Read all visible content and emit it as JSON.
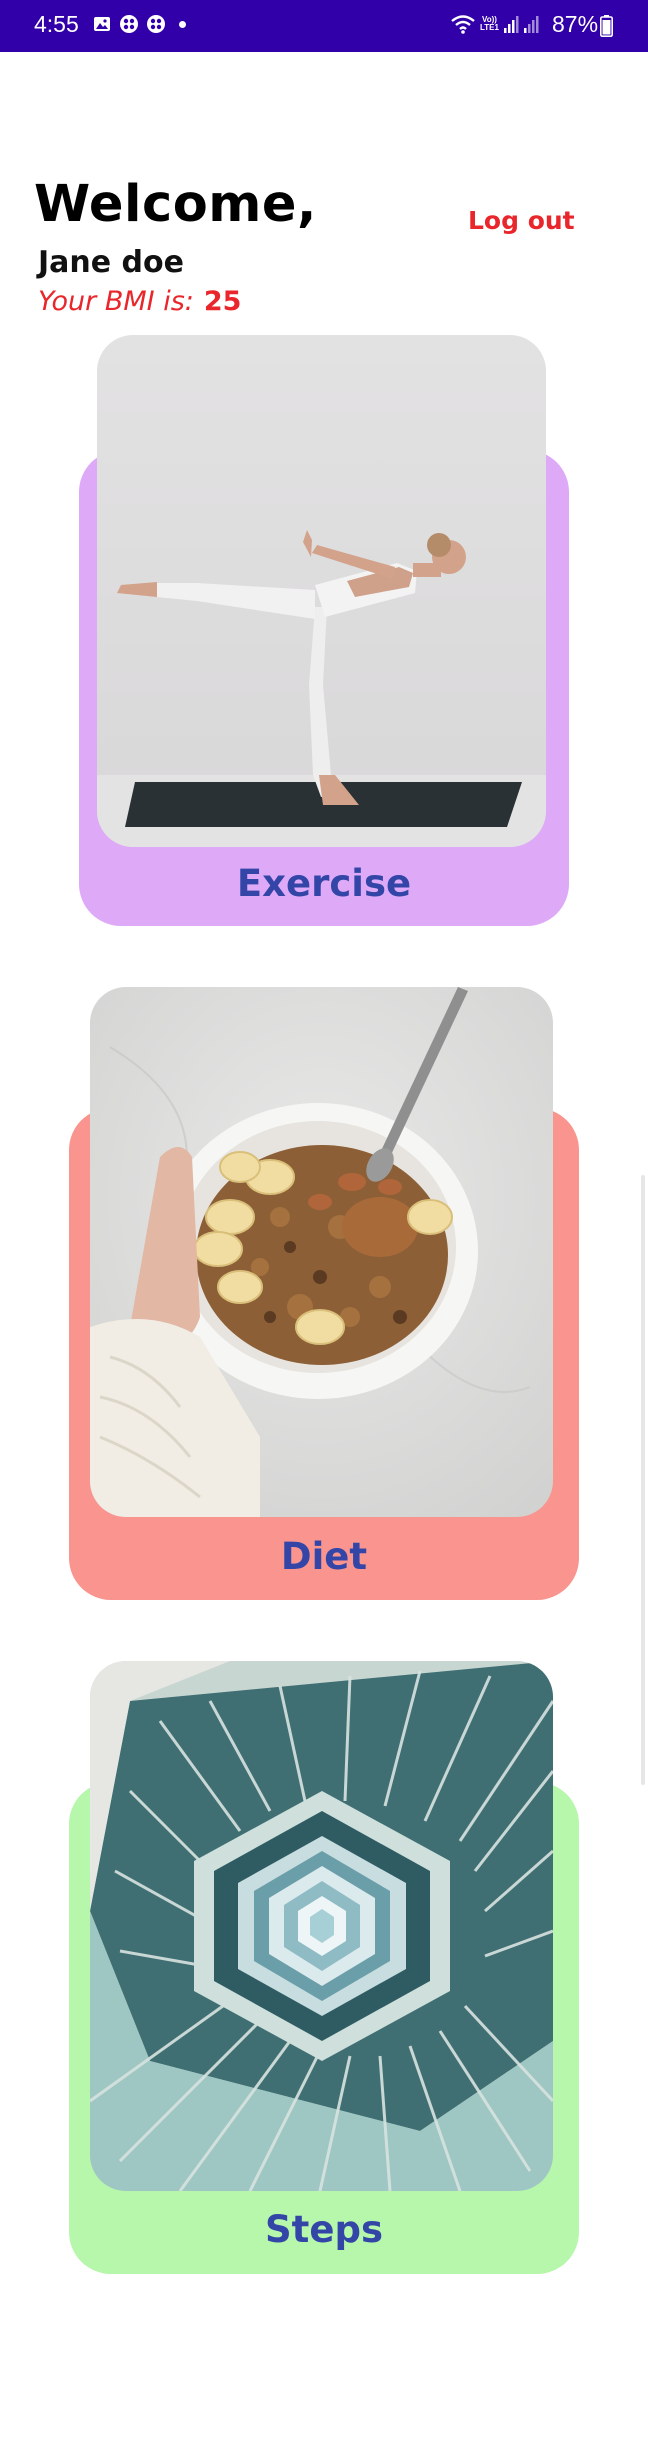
{
  "status_bar": {
    "time": "4:55",
    "battery": "87%",
    "volte_top": "Vo))",
    "volte_bottom": "LTE1",
    "icons": [
      "gallery-icon",
      "app-icon",
      "app-icon",
      "notification-dot",
      "wifi-icon",
      "signal-icon",
      "signal-icon",
      "battery-icon"
    ]
  },
  "header": {
    "welcome": "Welcome,",
    "user_name": "Jane doe",
    "bmi_label": "Your BMI is:",
    "bmi_value": "25",
    "logout_label": "Log out"
  },
  "cards": [
    {
      "label": "Exercise",
      "color": "#deaaf7",
      "image": "yoga-pose-image"
    },
    {
      "label": "Diet",
      "color": "#f9948e",
      "image": "granola-bowl-image"
    },
    {
      "label": "Steps",
      "color": "#b6f7ab",
      "image": "spiral-staircase-image"
    }
  ],
  "colors": {
    "status_bar": "#3200a8",
    "accent_red": "#e8262b",
    "card_label": "#3346a8"
  }
}
